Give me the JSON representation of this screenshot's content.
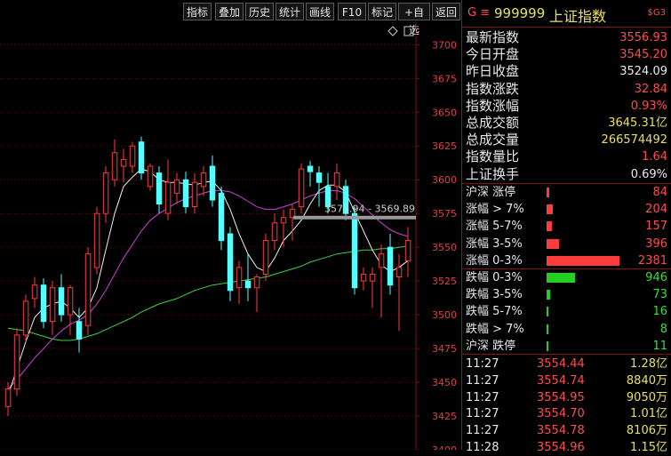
{
  "toolbar": {
    "buttons": [
      "指标",
      "叠加",
      "历史",
      "统计",
      "画线",
      "F10",
      "标记",
      "+自选",
      "返回"
    ]
  },
  "chart_data": {
    "type": "candlestick",
    "y_ticks": [
      3700,
      3675,
      3650,
      3625,
      3600,
      3575,
      3550,
      3525,
      3500,
      3475,
      3450,
      3425,
      3400
    ],
    "ylim": [
      3400,
      3716
    ],
    "crosshair_label": "3573.94 - 3569.89",
    "crosshair_value": 3572,
    "candles": [
      {
        "o": 3432,
        "h": 3450,
        "l": 3425,
        "c": 3445
      },
      {
        "o": 3445,
        "h": 3490,
        "l": 3440,
        "c": 3485
      },
      {
        "o": 3485,
        "h": 3515,
        "l": 3480,
        "c": 3510
      },
      {
        "o": 3512,
        "h": 3528,
        "l": 3505,
        "c": 3522
      },
      {
        "o": 3522,
        "h": 3527,
        "l": 3490,
        "c": 3495
      },
      {
        "o": 3495,
        "h": 3525,
        "l": 3485,
        "c": 3520
      },
      {
        "o": 3520,
        "h": 3530,
        "l": 3495,
        "c": 3500
      },
      {
        "o": 3500,
        "h": 3522,
        "l": 3485,
        "c": 3520
      },
      {
        "o": 3495,
        "h": 3505,
        "l": 3472,
        "c": 3482
      },
      {
        "o": 3492,
        "h": 3550,
        "l": 3485,
        "c": 3545
      },
      {
        "o": 3535,
        "h": 3580,
        "l": 3530,
        "c": 3575
      },
      {
        "o": 3575,
        "h": 3610,
        "l": 3568,
        "c": 3605
      },
      {
        "o": 3600,
        "h": 3630,
        "l": 3595,
        "c": 3620
      },
      {
        "o": 3610,
        "h": 3623,
        "l": 3598,
        "c": 3615
      },
      {
        "o": 3610,
        "h": 3628,
        "l": 3605,
        "c": 3625
      },
      {
        "o": 3628,
        "h": 3632,
        "l": 3600,
        "c": 3605
      },
      {
        "o": 3595,
        "h": 3612,
        "l": 3592,
        "c": 3610
      },
      {
        "o": 3605,
        "h": 3610,
        "l": 3575,
        "c": 3582
      },
      {
        "o": 3575,
        "h": 3615,
        "l": 3570,
        "c": 3598
      },
      {
        "o": 3590,
        "h": 3605,
        "l": 3582,
        "c": 3600
      },
      {
        "o": 3600,
        "h": 3606,
        "l": 3575,
        "c": 3580
      },
      {
        "o": 3580,
        "h": 3605,
        "l": 3575,
        "c": 3598
      },
      {
        "o": 3595,
        "h": 3610,
        "l": 3588,
        "c": 3605
      },
      {
        "o": 3610,
        "h": 3618,
        "l": 3580,
        "c": 3585
      },
      {
        "o": 3590,
        "h": 3595,
        "l": 3548,
        "c": 3555
      },
      {
        "o": 3560,
        "h": 3565,
        "l": 3510,
        "c": 3518
      },
      {
        "o": 3520,
        "h": 3540,
        "l": 3508,
        "c": 3535
      },
      {
        "o": 3525,
        "h": 3545,
        "l": 3510,
        "c": 3520
      },
      {
        "o": 3520,
        "h": 3530,
        "l": 3502,
        "c": 3528
      },
      {
        "o": 3530,
        "h": 3560,
        "l": 3525,
        "c": 3555
      },
      {
        "o": 3555,
        "h": 3575,
        "l": 3548,
        "c": 3568
      },
      {
        "o": 3568,
        "h": 3578,
        "l": 3550,
        "c": 3572
      },
      {
        "o": 3572,
        "h": 3582,
        "l": 3555,
        "c": 3578
      },
      {
        "o": 3580,
        "h": 3612,
        "l": 3575,
        "c": 3608
      },
      {
        "o": 3610,
        "h": 3614,
        "l": 3595,
        "c": 3606
      },
      {
        "o": 3605,
        "h": 3610,
        "l": 3580,
        "c": 3598
      },
      {
        "o": 3595,
        "h": 3605,
        "l": 3575,
        "c": 3580
      },
      {
        "o": 3595,
        "h": 3612,
        "l": 3585,
        "c": 3605
      },
      {
        "o": 3595,
        "h": 3600,
        "l": 3570,
        "c": 3575
      },
      {
        "o": 3575,
        "h": 3580,
        "l": 3515,
        "c": 3520
      },
      {
        "o": 3525,
        "h": 3535,
        "l": 3518,
        "c": 3530
      },
      {
        "o": 3525,
        "h": 3535,
        "l": 3505,
        "c": 3530
      },
      {
        "o": 3535,
        "h": 3552,
        "l": 3498,
        "c": 3545
      },
      {
        "o": 3550,
        "h": 3560,
        "l": 3515,
        "c": 3522
      },
      {
        "o": 3528,
        "h": 3545,
        "l": 3488,
        "c": 3535
      },
      {
        "o": 3540,
        "h": 3565,
        "l": 3528,
        "c": 3555
      }
    ],
    "ma_short": [
      3440,
      3460,
      3480,
      3498,
      3505,
      3508,
      3510,
      3505,
      3498,
      3505,
      3520,
      3548,
      3575,
      3595,
      3602,
      3608,
      3606,
      3600,
      3598,
      3598,
      3597,
      3596,
      3598,
      3599,
      3592,
      3578,
      3560,
      3545,
      3535,
      3532,
      3542,
      3555,
      3562,
      3570,
      3582,
      3592,
      3596,
      3596,
      3591,
      3576,
      3562,
      3548,
      3537,
      3532,
      3535,
      3540
    ],
    "ma_mid": [
      3445,
      3452,
      3460,
      3468,
      3475,
      3482,
      3488,
      3493,
      3496,
      3500,
      3508,
      3518,
      3530,
      3542,
      3552,
      3562,
      3570,
      3575,
      3579,
      3583,
      3586,
      3588,
      3590,
      3592,
      3592,
      3591,
      3588,
      3584,
      3580,
      3578,
      3578,
      3580,
      3582,
      3585,
      3588,
      3590,
      3592,
      3592,
      3590,
      3586,
      3580,
      3574,
      3568,
      3563,
      3560,
      3558
    ],
    "ma_long": [
      3490,
      3489,
      3488,
      3486,
      3484,
      3482,
      3481,
      3481,
      3482,
      3484,
      3486,
      3489,
      3492,
      3495,
      3498,
      3502,
      3505,
      3508,
      3510,
      3512,
      3515,
      3518,
      3520,
      3522,
      3523,
      3524,
      3525,
      3526,
      3527,
      3528,
      3530,
      3532,
      3534,
      3536,
      3539,
      3541,
      3543,
      3545,
      3546,
      3547,
      3548,
      3548,
      3549,
      3549,
      3550,
      3551
    ]
  },
  "header": {
    "code_prefix": "G ≡",
    "code": "999999",
    "name": "上证指数",
    "tag": "$G3"
  },
  "stats": [
    {
      "label": "最新指数",
      "value": "3556.93",
      "color": "#ff4d4d"
    },
    {
      "label": "今日开盘",
      "value": "3545.20",
      "color": "#ff4d4d"
    },
    {
      "label": "昨日收盘",
      "value": "3524.09",
      "color": "#eaeaea"
    },
    {
      "label": "指数涨跌",
      "value": "32.84",
      "color": "#ff4d4d"
    },
    {
      "label": "指数涨幅",
      "value": "0.93%",
      "color": "#ff4d4d"
    },
    {
      "label": "总成交额",
      "value": "3645.31亿",
      "color": "#e7e060"
    },
    {
      "label": "总成交量",
      "value": "266574492",
      "color": "#e7e060"
    },
    {
      "label": "指数量比",
      "value": "1.64",
      "color": "#ff4d4d"
    },
    {
      "label": "上证换手",
      "value": "0.69%",
      "color": "#eaeaea"
    }
  ],
  "dist_up": [
    {
      "label": "沪深 涨停",
      "value": "84",
      "fraction": 0.015
    },
    {
      "label": "涨幅 > 7%",
      "value": "204",
      "fraction": 0.035
    },
    {
      "label": "涨幅 5-7%",
      "value": "157",
      "fraction": 0.03
    },
    {
      "label": "涨幅 3-5%",
      "value": "396",
      "fraction": 0.07
    },
    {
      "label": "涨幅 0-3%",
      "value": "2381",
      "fraction": 0.41
    }
  ],
  "dist_down": [
    {
      "label": "跌幅 0-3%",
      "value": "946",
      "fraction": 0.16
    },
    {
      "label": "跌幅 3-5%",
      "value": "73",
      "fraction": 0.02
    },
    {
      "label": "跌幅 5-7%",
      "value": "16",
      "fraction": 0.004
    },
    {
      "label": "跌幅 > 7%",
      "value": "8",
      "fraction": 0.003
    },
    {
      "label": "沪深 跌停",
      "value": "11",
      "fraction": 0.003
    }
  ],
  "ticks": [
    {
      "time": "11:27",
      "price": "3554.44",
      "vol": "1.28亿"
    },
    {
      "time": "11:27",
      "price": "3554.74",
      "vol": "8840万"
    },
    {
      "time": "11:27",
      "price": "3554.95",
      "vol": "9050万"
    },
    {
      "time": "11:27",
      "price": "3554.70",
      "vol": "1.01亿"
    },
    {
      "time": "11:27",
      "price": "3554.78",
      "vol": "8106万"
    },
    {
      "time": "11:28",
      "price": "3554.96",
      "vol": "1.15亿"
    }
  ],
  "colors": {
    "up": "#ff3b3b",
    "down": "#54ffff",
    "ma_short": "#f0f0f0",
    "ma_mid": "#d040d0",
    "ma_long": "#3fd23f",
    "grid": "#7a1515",
    "up_bar": "#ff3b3b",
    "down_bar": "#22d022"
  }
}
